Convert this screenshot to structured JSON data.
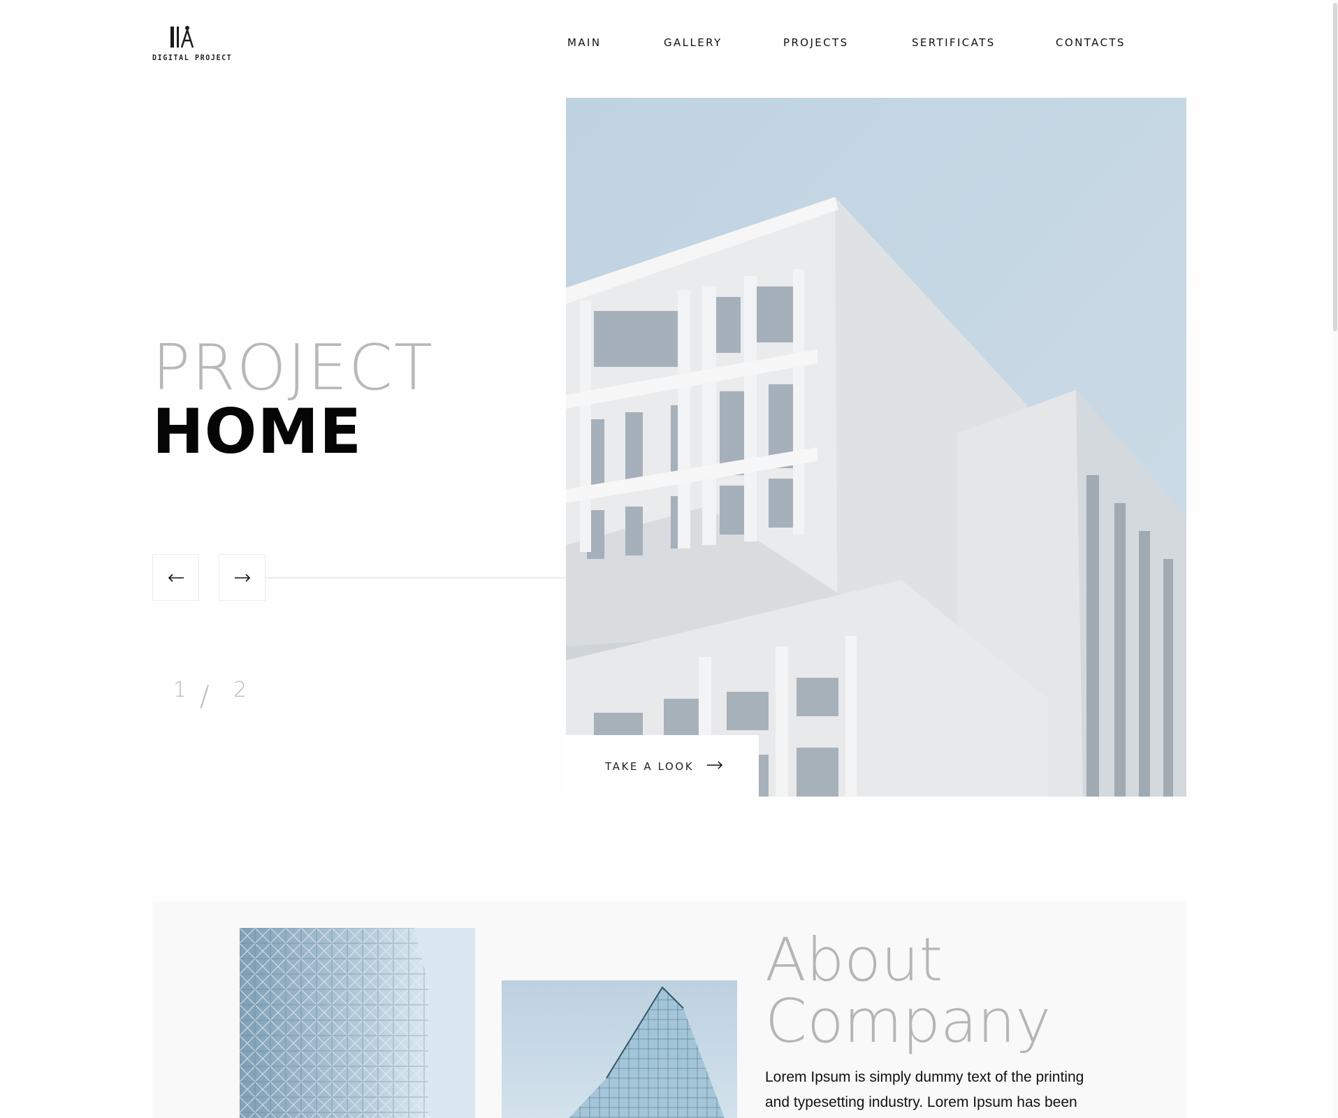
{
  "brand": {
    "logo_text": "DIGITAL PROJECT"
  },
  "nav": {
    "items": [
      "MAIN",
      "GALLERY",
      "PROJECTS",
      "SERTIFICATS",
      "CONTACTS"
    ]
  },
  "hero": {
    "title_light": "PROJECT",
    "title_bold": "HOME",
    "slide_current": "1",
    "slide_separator": "/",
    "slide_total": "2",
    "cta_label": "TAKE A LOOK",
    "prev_icon": "arrow-left-icon",
    "next_icon": "arrow-right-icon"
  },
  "about": {
    "title_line1": "About",
    "title_line2": "Company",
    "text": "Lorem Ipsum is simply dummy text of the printing and typesetting industry. Lorem Ipsum has been"
  },
  "colors": {
    "sky": "#c4d6e3",
    "building": "#ececec",
    "title_gray": "#b8b8b8",
    "panel": "#f9f9f9"
  }
}
